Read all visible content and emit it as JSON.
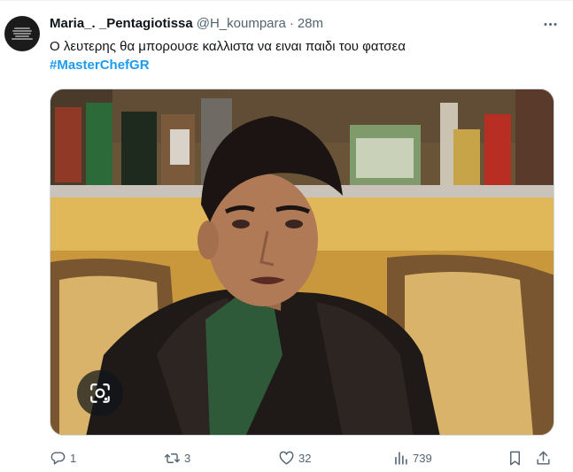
{
  "tweet": {
    "display_name": "Maria_. _Pentagiotissa",
    "handle": "@H_koumpara",
    "separator": "·",
    "time": "28m",
    "text": "Ο λευτερης θα μπορουσε καλλιστα να ειναι παιδι του φατσεα",
    "hashtag": "#MasterChefGR"
  },
  "actions": {
    "reply_count": "1",
    "retweet_count": "3",
    "like_count": "32",
    "views_count": "739"
  },
  "colors": {
    "text": "#0f1419",
    "secondary": "#536471",
    "link": "#1d9bf0"
  },
  "icons": [
    "more-icon",
    "lens-icon",
    "reply-icon",
    "retweet-icon",
    "like-icon",
    "views-icon",
    "bookmark-icon",
    "share-icon"
  ]
}
